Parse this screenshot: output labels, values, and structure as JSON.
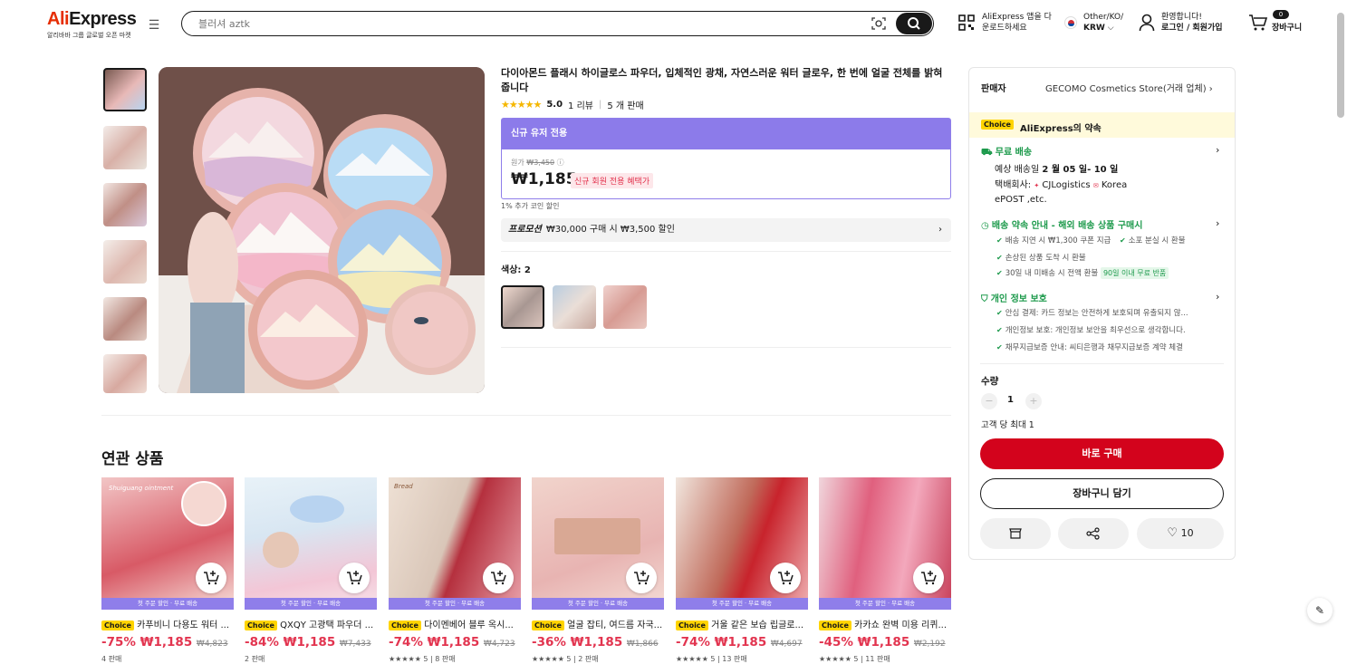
{
  "header": {
    "brand_prefix": "Ali",
    "brand_suffix": "Express",
    "tagline": "알리바바 그룹 글로벌 오픈 마켓",
    "search_placeholder": "블러셔 aztk",
    "app_line1": "AliExpress 앱을 다",
    "app_line2": "운로드하세요",
    "region_line1": "Other/KO/",
    "region_line2": "KRW",
    "user_line1": "환영합니다!",
    "user_line2": "로그인 / 회원가입",
    "cart_count": "0",
    "cart_label": "장바구니"
  },
  "product": {
    "title": "다이아몬드 플래시 하이글로스 파우더, 입체적인 광채, 자연스러운 워터 글로우, 한 번에 얼굴 전체를 밝혀줍니다",
    "stars": "★★★★★",
    "rating": "5.0",
    "reviews": "1 리뷰",
    "sold": "5 개 판매",
    "new_user_header": "신규 유저 전용",
    "orig_label": "원가",
    "orig_price": "₩3,450",
    "price": "₩1,185",
    "new_user_pill": "신규 회원 전용 혜택가",
    "coin_note": "1% 추가 코인 할인",
    "promo_label": "프로모션",
    "promo_text": "₩30,000 구매 시 ₩3,500 할인",
    "color_label": "색상: 2"
  },
  "panel": {
    "seller_label": "판매자",
    "seller_name": "GECOMO Cosmetics Store(거래 업체)",
    "choice_chip": "Choice",
    "choice_promise": "AliExpress의 약속",
    "free_shipping": "무료 배송",
    "delivery_prefix": "예상 배송일",
    "delivery_dates": "2 월 05 일- 10 일",
    "carrier_prefix": "택배회사:",
    "carrier1": "CJLogistics",
    "carrier2": "Korea",
    "carrier3": "ePOST ,etc.",
    "guarantee_title": "배송 약속 안내 - 해외 배송 상품 구매시",
    "g1": "배송 지연 시 ₩1,300 쿠폰 지급",
    "g2": "소포 분실 시 환불",
    "g3": "손상된 상품 도착 시 환불",
    "g4": "30일 내 미배송 시 전액 환불",
    "g4_tag": "90일 이내 무료 반품",
    "privacy_title": "개인 정보 보호",
    "p1": "안심 결제: 카드 정보는 안전하게 보호되며 유출되지 않...",
    "p2": "개인정보 보호: 개인정보 보안을 최우선으로 생각합니다.",
    "p3": "채무지급보증 안내: 씨티은행과 채무지급보증 계약 체결",
    "qty_label": "수량",
    "qty_minus": "−",
    "qty_value": "1",
    "qty_plus": "+",
    "qty_max": "고객 당 최대 1",
    "buy_now": "바로 구매",
    "add_cart": "장바구니 담기",
    "wish_count": "10"
  },
  "related": {
    "title": "연관 상품",
    "band": "첫 주문 할인 · 무료 배송",
    "items": [
      {
        "name": "카푸비니 다용도 워터 ...",
        "discount": "-75%",
        "price": "₩1,185",
        "orig": "₩4,823",
        "sold": "4 판매",
        "overlay": "Shuiguang ointment"
      },
      {
        "name": "QXQY 고광택 파우더 ...",
        "discount": "-84%",
        "price": "₩1,185",
        "orig": "₩7,433",
        "sold": "2 판매"
      },
      {
        "name": "다이멘베어 블루 옥시...",
        "discount": "-74%",
        "price": "₩1,185",
        "orig": "₩4,723",
        "sold": "★★★★★ 5 | 8 판매"
      },
      {
        "name": "얼굴 잡티, 여드름 자국...",
        "discount": "-36%",
        "price": "₩1,185",
        "orig": "₩1,866",
        "sold": "★★★★★ 5 | 2 판매"
      },
      {
        "name": "거울 같은 보습 립글로...",
        "discount": "-74%",
        "price": "₩1,185",
        "orig": "₩4,697",
        "sold": "★★★★★ 5 | 13 판매"
      },
      {
        "name": "카카쇼 완벽 미용 리퀴...",
        "discount": "-45%",
        "price": "₩1,185",
        "orig": "₩2,192",
        "sold": "★★★★★ 5 | 11 판매"
      }
    ]
  },
  "colors": {
    "accent": "#e62e04",
    "buy": "#d3031c",
    "promo_purple": "#8c7bea",
    "price_red": "#e2344f",
    "green": "#1d9a4c"
  }
}
